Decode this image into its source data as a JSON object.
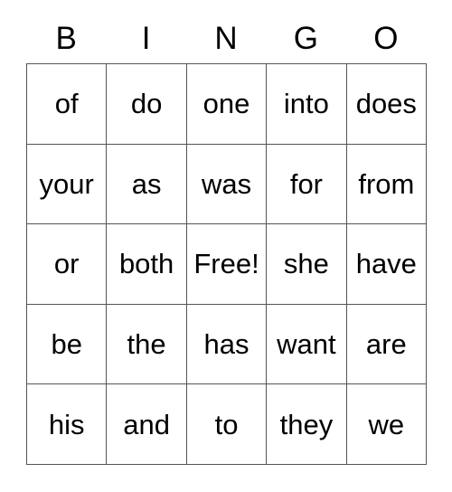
{
  "card": {
    "title": "BINGO",
    "header": {
      "letters": [
        "B",
        "I",
        "N",
        "G",
        "O"
      ]
    },
    "colors": {
      "background": "#ffffff",
      "grid_line": "#555555",
      "text": "#000000"
    },
    "free_space": {
      "label": "Free!",
      "row": 3,
      "column": 3
    },
    "rows": [
      {
        "cells": [
          {
            "text": "of"
          },
          {
            "text": "do"
          },
          {
            "text": "one"
          },
          {
            "text": "into"
          },
          {
            "text": "does"
          }
        ]
      },
      {
        "cells": [
          {
            "text": "your"
          },
          {
            "text": "as"
          },
          {
            "text": "was"
          },
          {
            "text": "for"
          },
          {
            "text": "from"
          }
        ]
      },
      {
        "cells": [
          {
            "text": "or"
          },
          {
            "text": "both"
          },
          {
            "text": "Free!"
          },
          {
            "text": "she"
          },
          {
            "text": "have"
          }
        ]
      },
      {
        "cells": [
          {
            "text": "be"
          },
          {
            "text": "the"
          },
          {
            "text": "has"
          },
          {
            "text": "want"
          },
          {
            "text": "are"
          }
        ]
      },
      {
        "cells": [
          {
            "text": "his"
          },
          {
            "text": "and"
          },
          {
            "text": "to"
          },
          {
            "text": "they"
          },
          {
            "text": "we"
          }
        ]
      }
    ]
  }
}
